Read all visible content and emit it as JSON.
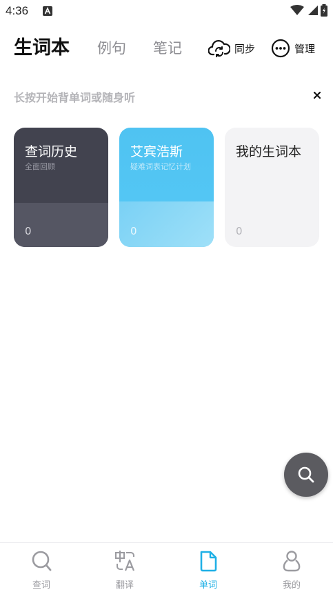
{
  "status_bar": {
    "time": "4:36"
  },
  "header": {
    "tabs": [
      {
        "label": "生词本",
        "active": true
      },
      {
        "label": "例句",
        "active": false
      },
      {
        "label": "笔记",
        "active": false
      }
    ],
    "sync_label": "同步",
    "manage_label": "管理"
  },
  "hint": {
    "text": "长按开始背单词或随身听"
  },
  "cards": [
    {
      "title": "查词历史",
      "subtitle": "全面回顾",
      "count": "0"
    },
    {
      "title": "艾宾浩斯",
      "subtitle": "疑难词表记忆计划",
      "count": "0"
    },
    {
      "title": "我的生词本",
      "subtitle": "",
      "count": "0"
    }
  ],
  "bottom_nav": {
    "items": [
      {
        "label": "查词",
        "icon": "search-icon"
      },
      {
        "label": "翻译",
        "icon": "translate-icon"
      },
      {
        "label": "单词",
        "icon": "document-icon",
        "active": true
      },
      {
        "label": "我的",
        "icon": "person-icon"
      }
    ]
  },
  "colors": {
    "accent": "#1fb0e6",
    "card_history": "#42434f",
    "card_ebbinghaus": "#4fc3f2",
    "card_mine": "#f3f3f5"
  }
}
